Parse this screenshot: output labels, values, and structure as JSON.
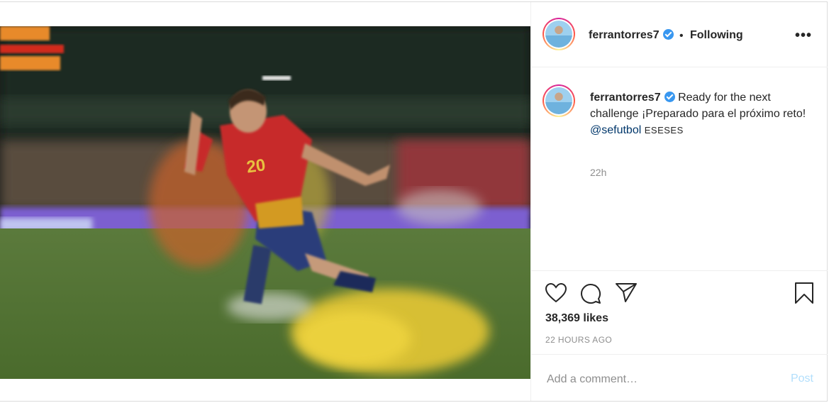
{
  "post": {
    "author": {
      "username": "ferrantorres7",
      "verified": true,
      "follow_separator": "•",
      "follow_status": "Following"
    },
    "more_icon": "more-horizontal-icon",
    "more_label": "•••",
    "caption": {
      "username": "ferrantorres7",
      "text_line": "Ready for the next challenge ¡Preparado para el próximo reto!",
      "mention": "@sefutbol",
      "tail": "ESESES",
      "time": "22h"
    },
    "actions": {
      "like_icon": "heart-icon",
      "comment_icon": "comment-icon",
      "share_icon": "paper-plane-icon",
      "save_icon": "bookmark-icon"
    },
    "likes": "38,369 likes",
    "time_ago": "22 HOURS AGO",
    "comment": {
      "placeholder": "Add a comment…",
      "post_label": "Post"
    },
    "colors": {
      "verified_blue": "#3897f0",
      "post_button_disabled": "#b2dffc",
      "mention": "#00376b",
      "muted": "#8e8e8e"
    }
  }
}
